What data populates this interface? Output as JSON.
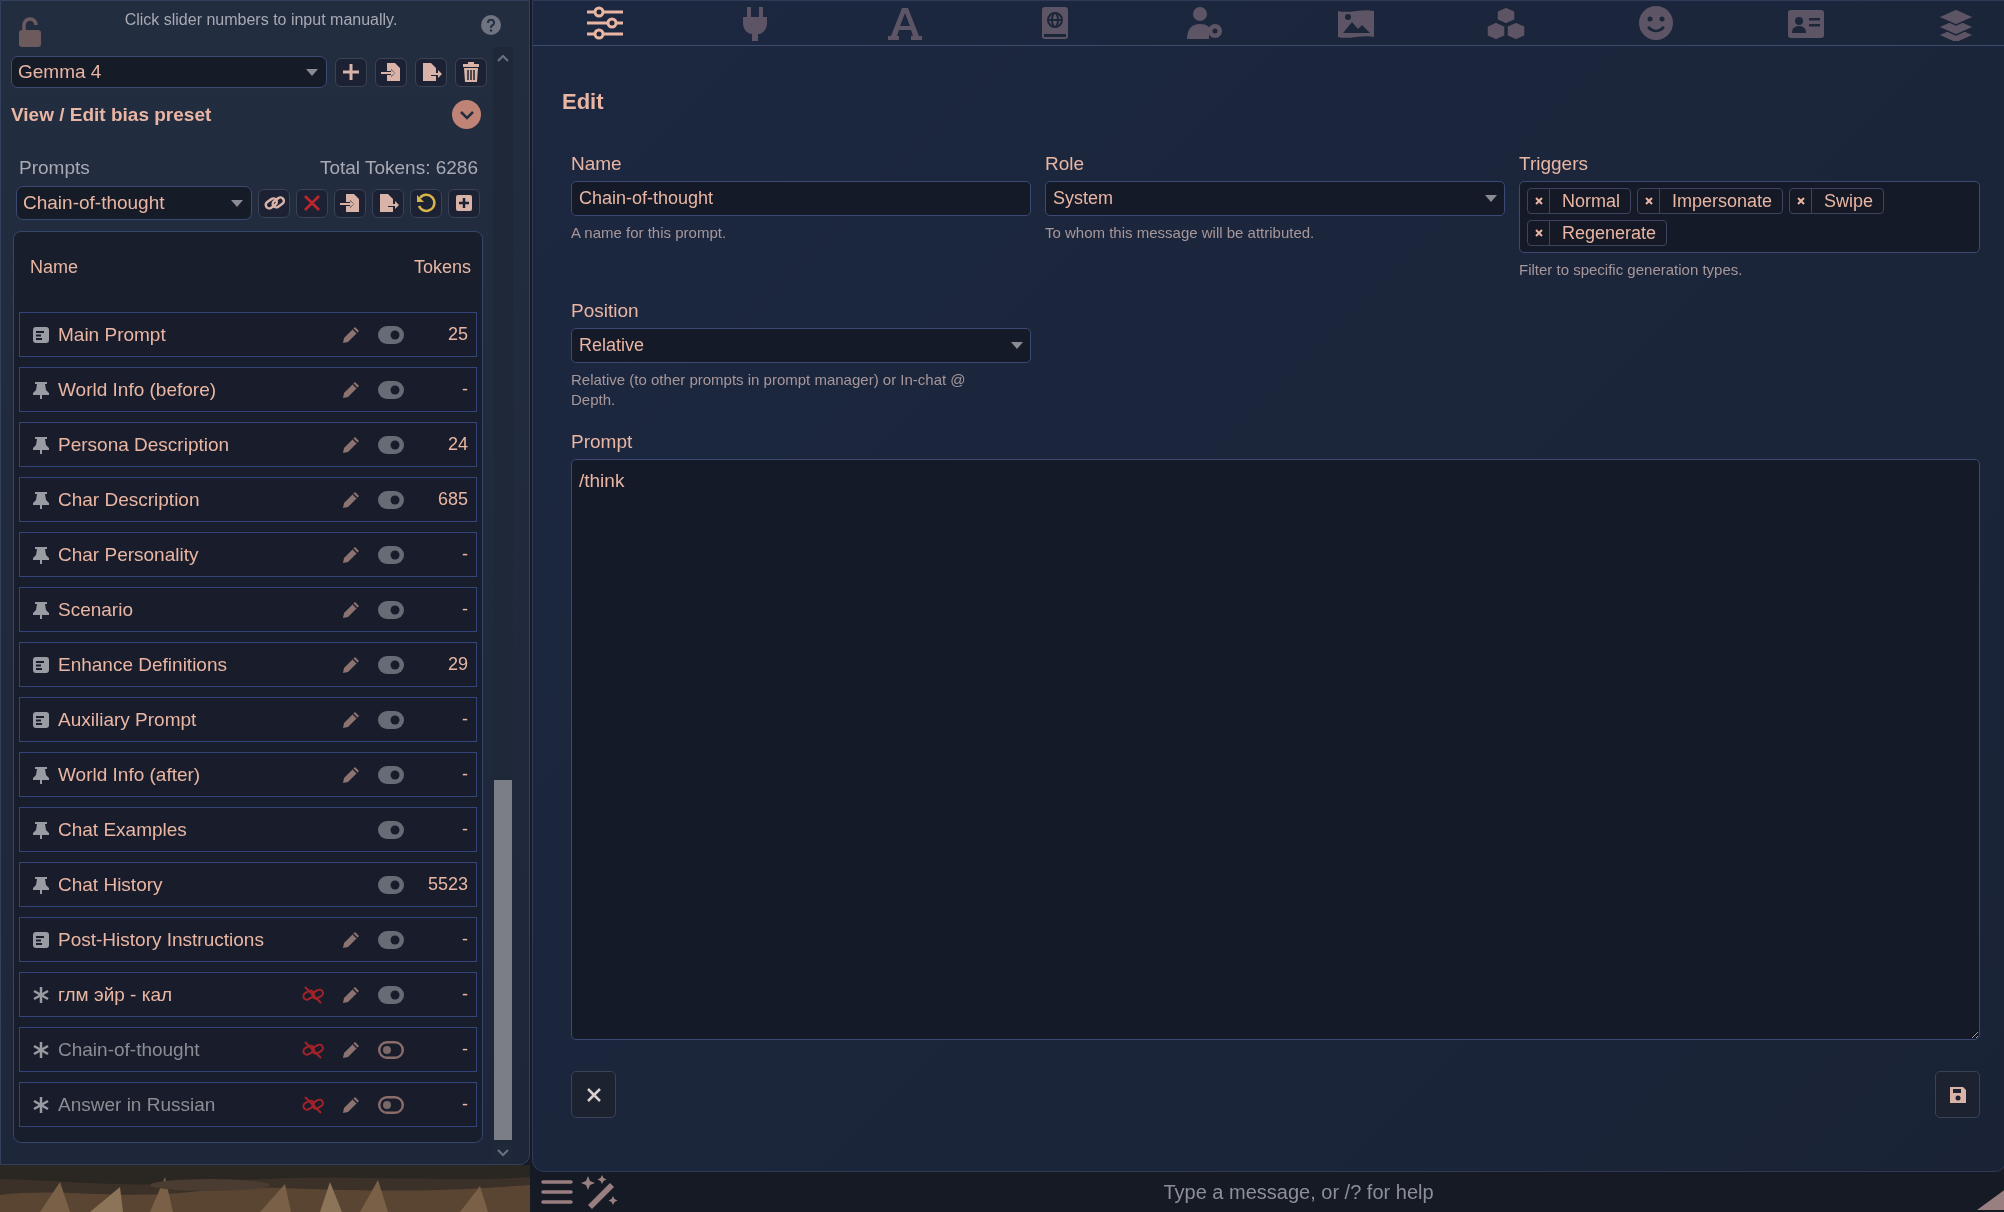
{
  "nav_tabs": [
    {
      "selected": true
    },
    {
      "selected": false
    },
    {
      "selected": false
    },
    {
      "selected": false
    },
    {
      "selected": false
    },
    {
      "selected": false
    },
    {
      "selected": false
    },
    {
      "selected": false
    },
    {
      "selected": false
    },
    {
      "selected": false
    }
  ],
  "left_panel": {
    "hint": "Click slider numbers to input manually.",
    "preset": {
      "value": "Gemma 4"
    },
    "section_title": "View / Edit bias preset",
    "prompts_label": "Prompts",
    "total_tokens": "Total Tokens: 6286",
    "prompt_select": {
      "value": "Chain-of-thought"
    },
    "table": {
      "columns": [
        "Name",
        "Tokens"
      ],
      "rows": [
        {
          "kind": "text",
          "name": "Main Prompt",
          "editable": true,
          "unlinked": false,
          "enabled": true,
          "tokens": "25"
        },
        {
          "kind": "marker",
          "name": "World Info (before)",
          "editable": true,
          "unlinked": false,
          "enabled": true,
          "tokens": "-"
        },
        {
          "kind": "marker",
          "name": "Persona Description",
          "editable": true,
          "unlinked": false,
          "enabled": true,
          "tokens": "24"
        },
        {
          "kind": "marker",
          "name": "Char Description",
          "editable": true,
          "unlinked": false,
          "enabled": true,
          "tokens": "685"
        },
        {
          "kind": "marker",
          "name": "Char Personality",
          "editable": true,
          "unlinked": false,
          "enabled": true,
          "tokens": "-"
        },
        {
          "kind": "marker",
          "name": "Scenario",
          "editable": true,
          "unlinked": false,
          "enabled": true,
          "tokens": "-"
        },
        {
          "kind": "text",
          "name": "Enhance Definitions",
          "editable": true,
          "unlinked": false,
          "enabled": true,
          "tokens": "29"
        },
        {
          "kind": "text",
          "name": "Auxiliary Prompt",
          "editable": true,
          "unlinked": false,
          "enabled": true,
          "tokens": "-"
        },
        {
          "kind": "marker",
          "name": "World Info (after)",
          "editable": true,
          "unlinked": false,
          "enabled": true,
          "tokens": "-"
        },
        {
          "kind": "marker",
          "name": "Chat Examples",
          "editable": false,
          "unlinked": false,
          "enabled": true,
          "tokens": "-"
        },
        {
          "kind": "marker",
          "name": "Chat History",
          "editable": false,
          "unlinked": false,
          "enabled": true,
          "tokens": "5523"
        },
        {
          "kind": "text",
          "name": "Post-History Instructions",
          "editable": true,
          "unlinked": false,
          "enabled": true,
          "tokens": "-"
        },
        {
          "kind": "custom",
          "name": "глм эйр - кал",
          "editable": true,
          "unlinked": true,
          "enabled": true,
          "tokens": "-"
        },
        {
          "kind": "custom",
          "name": "Chain-of-thought",
          "editable": true,
          "unlinked": true,
          "enabled": false,
          "tokens": "-"
        },
        {
          "kind": "custom",
          "name": "Answer in Russian",
          "editable": true,
          "unlinked": true,
          "enabled": false,
          "tokens": "-"
        }
      ]
    }
  },
  "edit": {
    "title": "Edit",
    "name": {
      "label": "Name",
      "value": "Chain-of-thought",
      "hint": "A name for this prompt."
    },
    "role": {
      "label": "Role",
      "value": "System",
      "hint": "To whom this message will be attributed."
    },
    "triggers": {
      "label": "Triggers",
      "tags": [
        "Normal",
        "Impersonate",
        "Swipe",
        "Regenerate"
      ],
      "hint": "Filter to specific generation types."
    },
    "position": {
      "label": "Position",
      "value": "Relative",
      "hint": "Relative (to other prompts in prompt manager) or In-chat @ Depth."
    },
    "prompt": {
      "label": "Prompt",
      "value": "/think"
    }
  },
  "chat": {
    "placeholder": "Type a message, or /? for help"
  }
}
